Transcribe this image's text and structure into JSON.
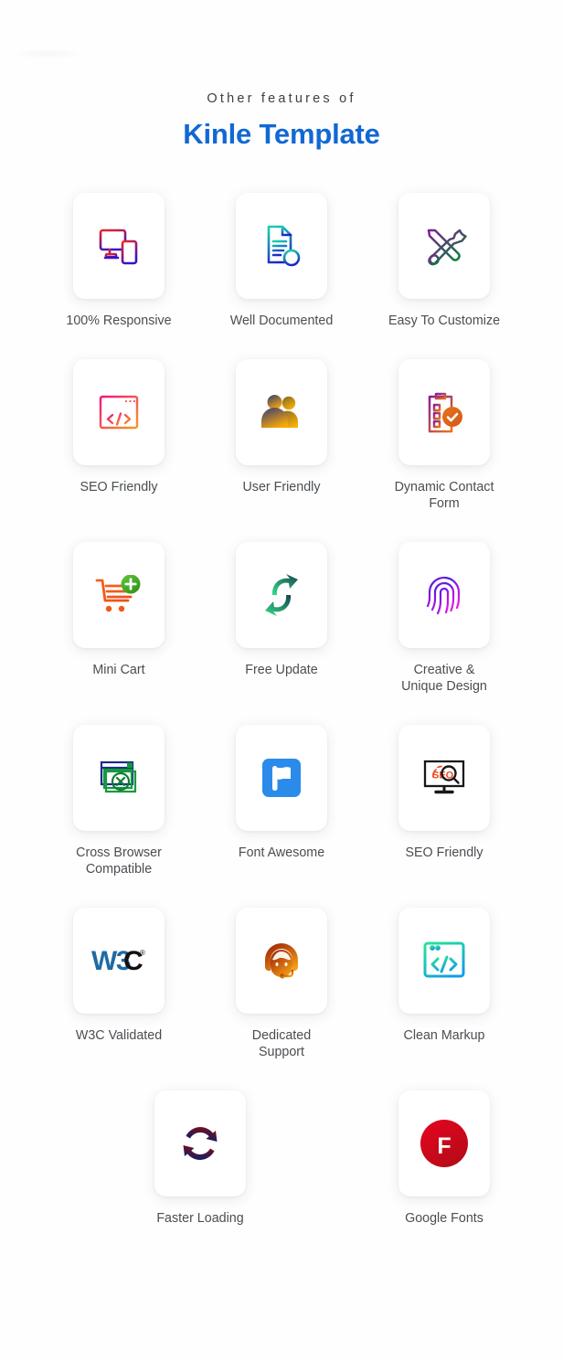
{
  "header": {
    "eyebrow": "Other features of",
    "headline": "Kinle Template",
    "headline_color": "#1268d3",
    "eyebrow_color": "#3d4142"
  },
  "theme": {
    "background": "#fefefe",
    "card_background": "#ffffff",
    "label_color": "#4a4e52"
  },
  "features": [
    {
      "label": "100% Responsive",
      "icon": "responsive-devices-icon",
      "colors": [
        "#ef2424",
        "#3a12c7"
      ]
    },
    {
      "label": "Well Documented",
      "icon": "document-info-icon",
      "colors": [
        "#18cfb0",
        "#1a24c9"
      ]
    },
    {
      "label": "Easy To Customize",
      "icon": "wrench-screwdriver-icon",
      "colors": [
        "#7d2390",
        "#0a7d3d"
      ]
    },
    {
      "label": "SEO Friendly",
      "icon": "code-window-icon",
      "colors": [
        "#f0157e",
        "#f79a22"
      ]
    },
    {
      "label": "User Friendly",
      "icon": "two-users-icon",
      "colors": [
        "#3b3f73",
        "#f9a806"
      ]
    },
    {
      "label": "Dynamic Contact\nForm",
      "icon": "clipboard-check-icon",
      "colors": [
        "#8e2192",
        "#e8731c"
      ]
    },
    {
      "label": "Mini Cart",
      "icon": "shopping-cart-plus-icon",
      "colors": [
        "#f2621d",
        "#45b035"
      ]
    },
    {
      "label": "Free Update",
      "icon": "refresh-arrows-icon",
      "colors": [
        "#134a52",
        "#35d98a"
      ]
    },
    {
      "label": "Creative &\nUnique Design",
      "icon": "fingerprint-icon",
      "colors": [
        "#3b1ae0",
        "#ec17e6"
      ]
    },
    {
      "label": "Cross Browser\nCompatible",
      "icon": "browser-close-icon",
      "colors": [
        "#1b2a8c",
        "#139a3c"
      ]
    },
    {
      "label": "Font Awesome",
      "icon": "flag-icon",
      "colors": [
        "#2b8bea",
        "#ffffff"
      ]
    },
    {
      "label": "SEO Friendly",
      "icon": "seo-monitor-search-icon",
      "colors": [
        "#1a1a1a",
        "#ef4823"
      ]
    },
    {
      "label": "W3C Validated",
      "icon": "w3c-logo-icon",
      "colors": [
        "#1f6aa5",
        "#111111"
      ]
    },
    {
      "label": "Dedicated\nSupport",
      "icon": "support-headset-icon",
      "colors": [
        "#9c2006",
        "#f6a015"
      ]
    },
    {
      "label": "Clean Markup",
      "icon": "clean-code-window-icon",
      "colors": [
        "#2ae09a",
        "#119ee5"
      ]
    },
    {
      "label": "Faster Loading",
      "icon": "sync-arrows-icon",
      "colors": [
        "#7a0d18",
        "#0d1f6b"
      ]
    },
    {
      "label": "Google Fonts",
      "icon": "google-fonts-f-icon",
      "colors": [
        "#e3051f",
        "#b30b18"
      ]
    }
  ]
}
